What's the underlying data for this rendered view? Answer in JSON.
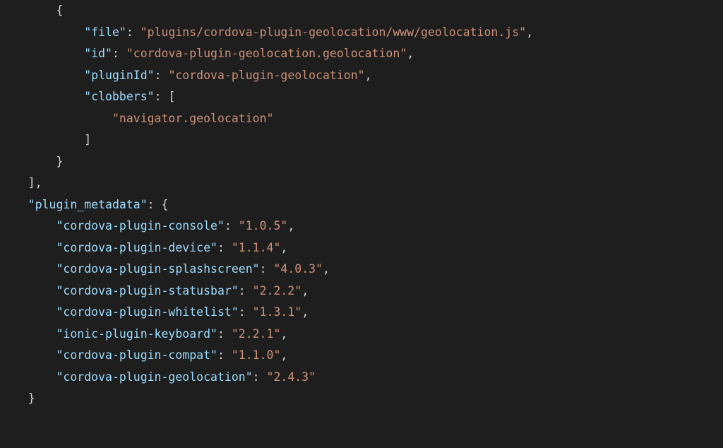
{
  "plugins_entry": {
    "file_key": "\"file\"",
    "file_val": "\"plugins/cordova-plugin-geolocation/www/geolocation.js\"",
    "id_key": "\"id\"",
    "id_val": "\"cordova-plugin-geolocation.geolocation\"",
    "pluginId_key": "\"pluginId\"",
    "pluginId_val": "\"cordova-plugin-geolocation\"",
    "clobbers_key": "\"clobbers\"",
    "clobbers_item": "\"navigator.geolocation\""
  },
  "plugin_metadata_key": "\"plugin_metadata\"",
  "plugin_metadata": {
    "k1": "\"cordova-plugin-console\"",
    "v1": "\"1.0.5\"",
    "k2": "\"cordova-plugin-device\"",
    "v2": "\"1.1.4\"",
    "k3": "\"cordova-plugin-splashscreen\"",
    "v3": "\"4.0.3\"",
    "k4": "\"cordova-plugin-statusbar\"",
    "v4": "\"2.2.2\"",
    "k5": "\"cordova-plugin-whitelist\"",
    "v5": "\"1.3.1\"",
    "k6": "\"ionic-plugin-keyboard\"",
    "v6": "\"2.2.1\"",
    "k7": "\"cordova-plugin-compat\"",
    "v7": "\"1.1.0\"",
    "k8": "\"cordova-plugin-geolocation\"",
    "v8": "\"2.4.3\""
  }
}
